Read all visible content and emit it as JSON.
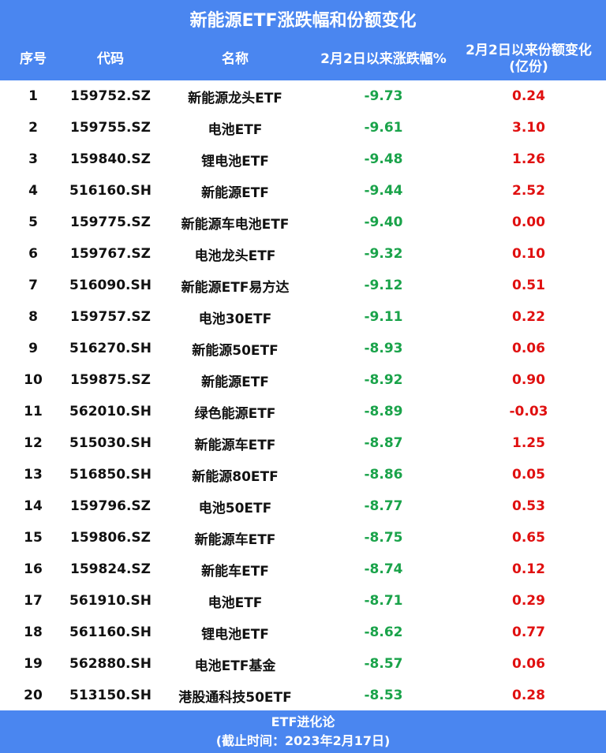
{
  "title": "新能源ETF涨跌幅和份额变化",
  "header": {
    "col_rank": "序号",
    "col_code": "代码",
    "col_name": "名称",
    "col_pct": "2月2日以来涨跌幅%",
    "col_change_line1": "2月2日以来份额变化",
    "col_change_line2": "(亿份)"
  },
  "colors": {
    "bar_blue": "#4a86f0",
    "negative_green": "#1aa34a",
    "change_red": "#e01010"
  },
  "rows": [
    {
      "rank": "1",
      "code": "159752.SZ",
      "name": "新能源龙头ETF",
      "pct": "-9.73",
      "change": "0.24"
    },
    {
      "rank": "2",
      "code": "159755.SZ",
      "name": "电池ETF",
      "pct": "-9.61",
      "change": "3.10"
    },
    {
      "rank": "3",
      "code": "159840.SZ",
      "name": "锂电池ETF",
      "pct": "-9.48",
      "change": "1.26"
    },
    {
      "rank": "4",
      "code": "516160.SH",
      "name": "新能源ETF",
      "pct": "-9.44",
      "change": "2.52"
    },
    {
      "rank": "5",
      "code": "159775.SZ",
      "name": "新能源车电池ETF",
      "pct": "-9.40",
      "change": "0.00"
    },
    {
      "rank": "6",
      "code": "159767.SZ",
      "name": "电池龙头ETF",
      "pct": "-9.32",
      "change": "0.10"
    },
    {
      "rank": "7",
      "code": "516090.SH",
      "name": "新能源ETF易方达",
      "pct": "-9.12",
      "change": "0.51"
    },
    {
      "rank": "8",
      "code": "159757.SZ",
      "name": "电池30ETF",
      "pct": "-9.11",
      "change": "0.22"
    },
    {
      "rank": "9",
      "code": "516270.SH",
      "name": "新能源50ETF",
      "pct": "-8.93",
      "change": "0.06"
    },
    {
      "rank": "10",
      "code": "159875.SZ",
      "name": "新能源ETF",
      "pct": "-8.92",
      "change": "0.90"
    },
    {
      "rank": "11",
      "code": "562010.SH",
      "name": "绿色能源ETF",
      "pct": "-8.89",
      "change": "-0.03"
    },
    {
      "rank": "12",
      "code": "515030.SH",
      "name": "新能源车ETF",
      "pct": "-8.87",
      "change": "1.25"
    },
    {
      "rank": "13",
      "code": "516850.SH",
      "name": "新能源80ETF",
      "pct": "-8.86",
      "change": "0.05"
    },
    {
      "rank": "14",
      "code": "159796.SZ",
      "name": "电池50ETF",
      "pct": "-8.77",
      "change": "0.53"
    },
    {
      "rank": "15",
      "code": "159806.SZ",
      "name": "新能源车ETF",
      "pct": "-8.75",
      "change": "0.65"
    },
    {
      "rank": "16",
      "code": "159824.SZ",
      "name": "新能车ETF",
      "pct": "-8.74",
      "change": "0.12"
    },
    {
      "rank": "17",
      "code": "561910.SH",
      "name": "电池ETF",
      "pct": "-8.71",
      "change": "0.29"
    },
    {
      "rank": "18",
      "code": "561160.SH",
      "name": "锂电池ETF",
      "pct": "-8.62",
      "change": "0.77"
    },
    {
      "rank": "19",
      "code": "562880.SH",
      "name": "电池ETF基金",
      "pct": "-8.57",
      "change": "0.06"
    },
    {
      "rank": "20",
      "code": "513150.SH",
      "name": "港股通科技50ETF",
      "pct": "-8.53",
      "change": "0.28"
    }
  ],
  "footer": {
    "source": "ETF进化论",
    "cutoff": "(截止时间：2023年2月17日)"
  }
}
